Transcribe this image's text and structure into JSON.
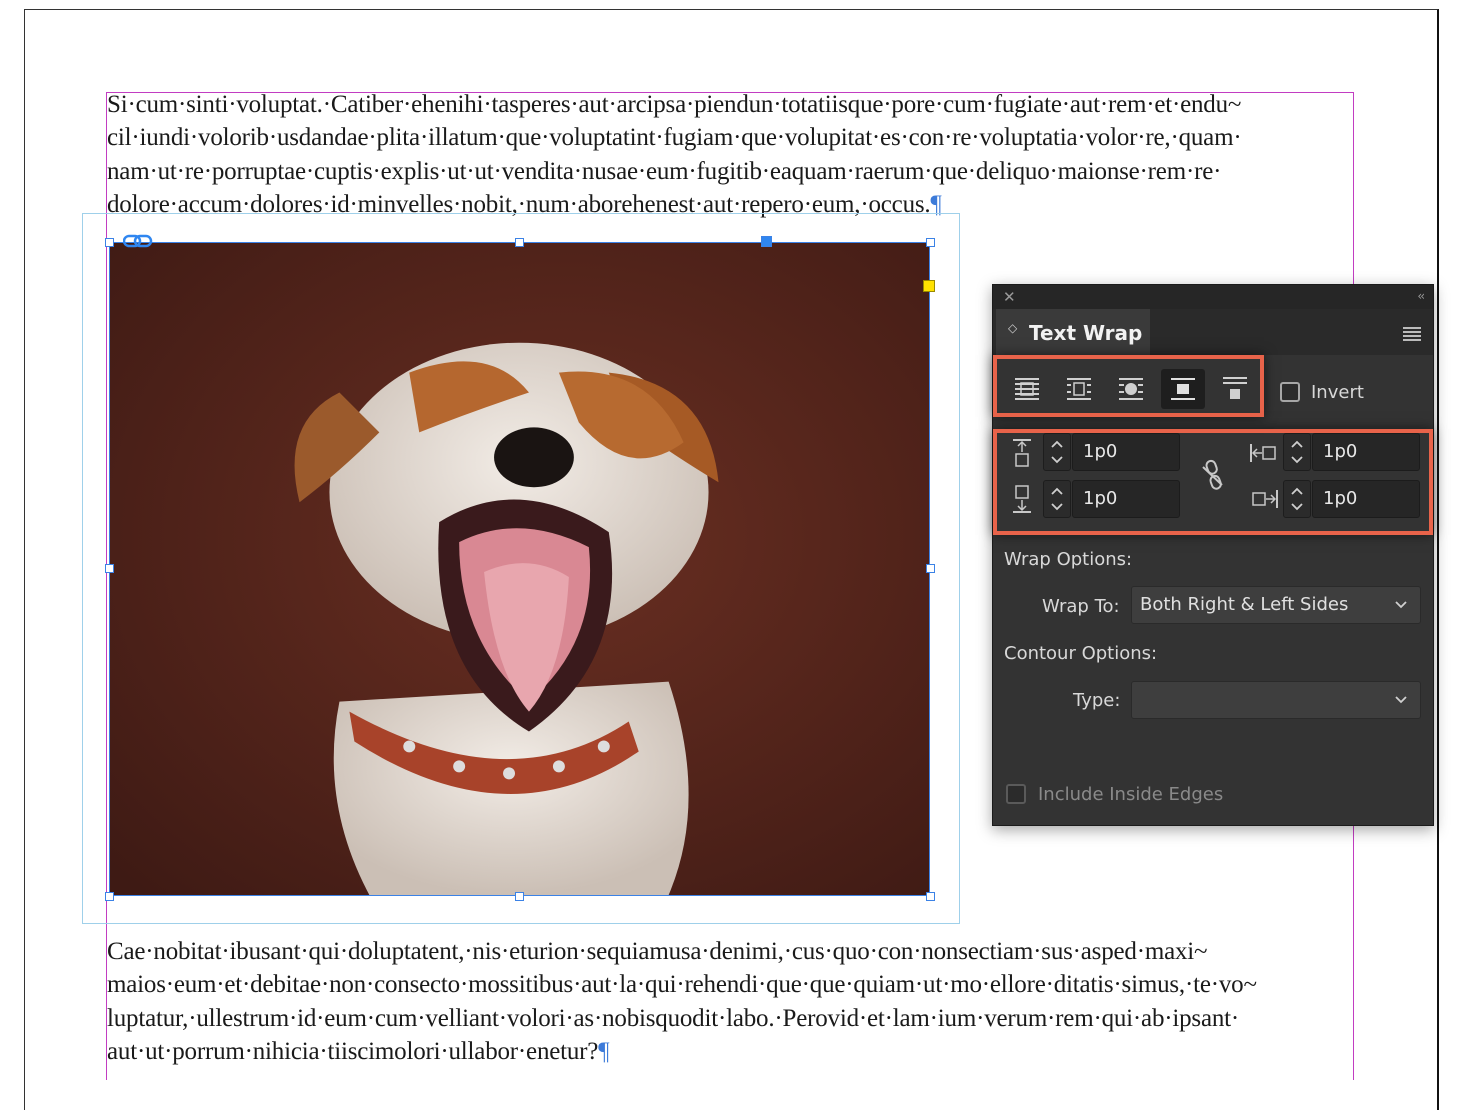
{
  "document": {
    "paragraph_top_lines": [
      "Si·cum·sinti·voluptat.·Catiber·ehenihi·tasperes·aut·arcipsa·piendun·totatiisque·pore·cum·fugiate·aut·rem·et·endu~",
      "cil·iundi·volorib·usdandae·plita·illatum·que·voluptatint·fugiam·que·volupitat·es·con·re·voluptatia·volor·re,·quam·",
      "nam·ut·re·porruptae·cuptis·explis·ut·ut·vendita·nusae·eum·fugitib·eaquam·raerum·que·deliquo·maionse·rem·re·",
      "dolore·accum·dolores·id·minvelles·nobit,·num·aborehenest·aut·repero·eum,·occus."
    ],
    "paragraph_bottom_lines": [
      "Cae·nobitat·ibusant·qui·doluptatent,·nis·eturion·sequiamusa·denimi,·cus·quo·con·nonsectiam·sus·asped·maxi~",
      "maios·eum·et·debitae·non·consecto·mossitibus·aut·la·qui·rehendi·que·que·quiam·ut·mo·ellore·ditatis·simus,·te·vo~",
      "luptatur,·ullestrum·id·eum·cum·velliant·volori·as·nobisquodit·labo.·Perovid·et·lam·ium·verum·rem·qui·ab·ipsant·",
      "aut·ut·porrum·nihicia·tiiscimolori·ullabor·enetur?"
    ],
    "pilcrow": "¶",
    "image_subject": "yawning-dog-photo"
  },
  "panel": {
    "close_glyph": "✕",
    "collapse_glyph": "‹‹",
    "tab_glyph": "◇",
    "title": "Text Wrap",
    "wrap_buttons": [
      {
        "name": "no-text-wrap",
        "selected": false
      },
      {
        "name": "wrap-around-bounding-box",
        "selected": false
      },
      {
        "name": "wrap-around-object-shape",
        "selected": false
      },
      {
        "name": "jump-object",
        "selected": true
      },
      {
        "name": "jump-to-next-column",
        "selected": false
      }
    ],
    "invert_label": "Invert",
    "offsets": {
      "top": "1p0",
      "bottom": "1p0",
      "left": "1p0",
      "right": "1p0"
    },
    "wrap_options_label": "Wrap Options:",
    "wrap_to_label": "Wrap To:",
    "wrap_to_value": "Both Right & Left Sides",
    "contour_options_label": "Contour Options:",
    "type_label": "Type:",
    "type_value": "",
    "include_inside_edges_label": "Include Inside Edges",
    "accent_color": "#e8634a"
  }
}
